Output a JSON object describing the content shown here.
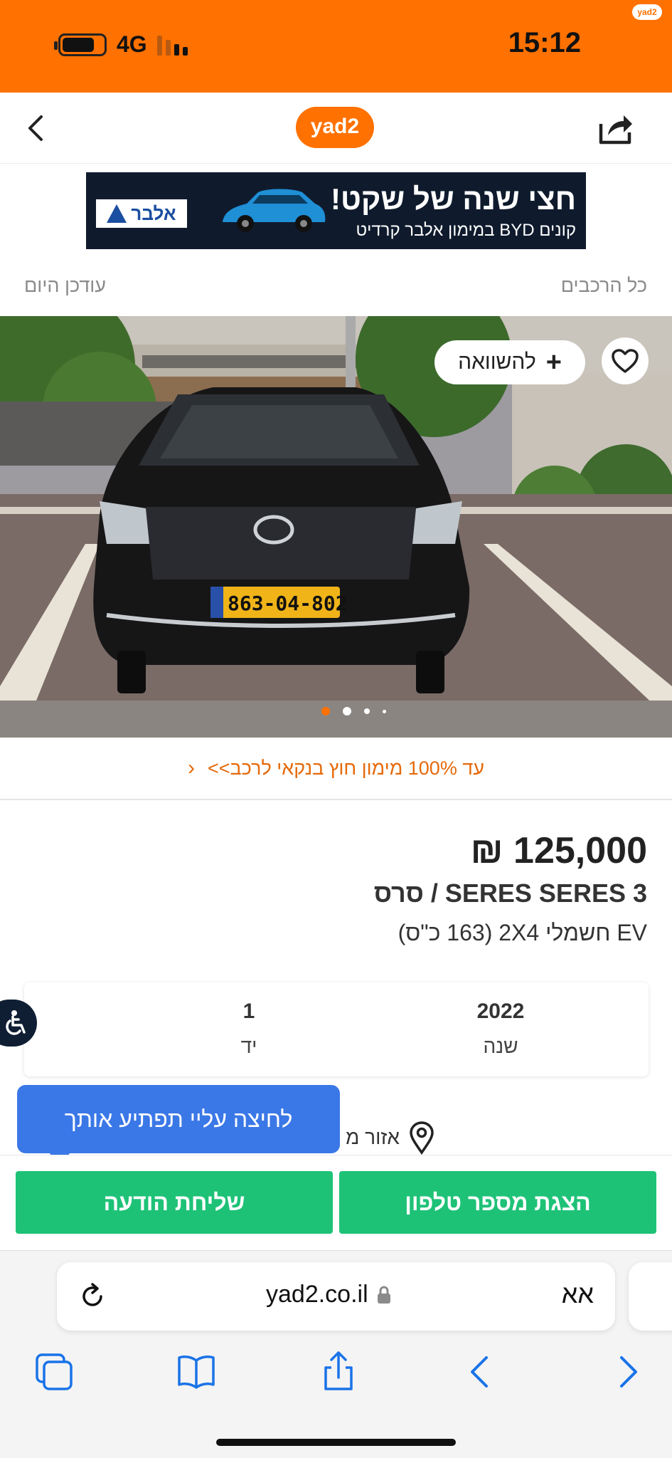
{
  "status_bar": {
    "time": "15:12",
    "network": "4G",
    "badge": "yad2"
  },
  "header": {
    "logo_text": "yad2"
  },
  "banner": {
    "headline": "חצי שנה של שקט!",
    "subline": "קונים BYD במימון אלבר קרדיט",
    "brand": "אלבר"
  },
  "breadcrumbs": {
    "all_vehicles": "כל הרכבים",
    "updated": "עודכן היום"
  },
  "photo": {
    "compare_label": "להשוואה",
    "plate": "863-04-802",
    "slide_count": 4,
    "active_slide": 1
  },
  "financing": {
    "text": "עד 100% מימון חוץ בנקאי לרכב>>"
  },
  "listing": {
    "price": "125,000 ₪",
    "title": "SERES SERES 3 / סרס",
    "subtitle": "EV חשמלי 2X4 (163 כ\"ס)"
  },
  "specs": [
    {
      "value": "2022",
      "label": "שנה"
    },
    {
      "value": "1",
      "label": "יד"
    }
  ],
  "location": {
    "label": "אזור מ"
  },
  "tooltip": {
    "text": "לחיצה עליי תפתיע אותך"
  },
  "actions": {
    "show_phone": "הצגת מספר טלפון",
    "send_message": "שליחת הודעה"
  },
  "browser": {
    "text_size": "אא",
    "url": "yad2.co.il"
  },
  "colors": {
    "brand_orange": "#ff7100",
    "cta_green": "#1ec277",
    "tooltip_blue": "#3b78e7",
    "finance_orange": "#e56a0b",
    "safari_blue": "#1a73e8"
  }
}
